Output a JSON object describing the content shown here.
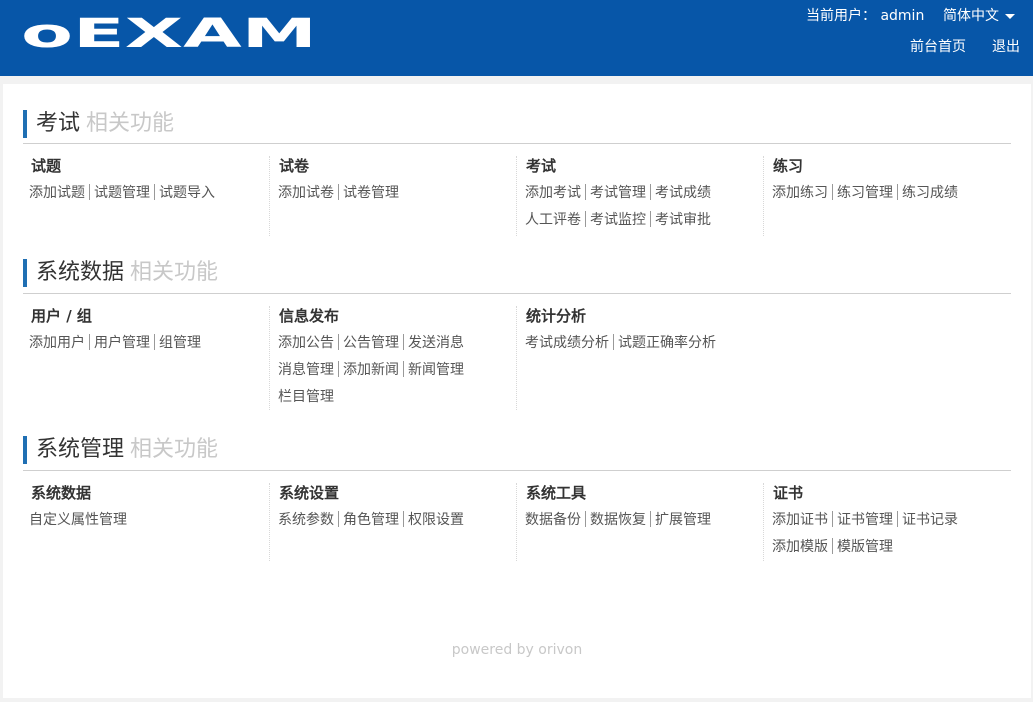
{
  "header": {
    "logo_text": "oEXAM",
    "current_user_label": "当前用户：",
    "current_user": "admin",
    "language": "简体中文",
    "front_home": "前台首页",
    "logout": "退出"
  },
  "sections": [
    {
      "title": "考试",
      "subtitle": "相关功能",
      "groups": [
        {
          "title": "试题",
          "rows": [
            [
              "添加试题",
              "试题管理",
              "试题导入"
            ]
          ]
        },
        {
          "title": "试卷",
          "rows": [
            [
              "添加试卷",
              "试卷管理"
            ]
          ]
        },
        {
          "title": "考试",
          "rows": [
            [
              "添加考试",
              "考试管理",
              "考试成绩"
            ],
            [
              "人工评卷",
              "考试监控",
              "考试审批"
            ]
          ]
        },
        {
          "title": "练习",
          "rows": [
            [
              "添加练习",
              "练习管理",
              "练习成绩"
            ]
          ]
        }
      ]
    },
    {
      "title": "系统数据",
      "subtitle": "相关功能",
      "groups": [
        {
          "title": "用户 / 组",
          "rows": [
            [
              "添加用户",
              "用户管理",
              "组管理"
            ]
          ]
        },
        {
          "title": "信息发布",
          "rows": [
            [
              "添加公告",
              "公告管理",
              "发送消息"
            ],
            [
              "消息管理",
              "添加新闻",
              "新闻管理"
            ],
            [
              "栏目管理"
            ]
          ]
        },
        {
          "title": "统计分析",
          "rows": [
            [
              "考试成绩分析",
              "试题正确率分析"
            ]
          ]
        }
      ]
    },
    {
      "title": "系统管理",
      "subtitle": "相关功能",
      "groups": [
        {
          "title": "系统数据",
          "rows": [
            [
              "自定义属性管理"
            ]
          ]
        },
        {
          "title": "系统设置",
          "rows": [
            [
              "系统参数",
              "角色管理",
              "权限设置"
            ]
          ]
        },
        {
          "title": "系统工具",
          "rows": [
            [
              "数据备份",
              "数据恢复",
              "扩展管理"
            ]
          ]
        },
        {
          "title": "证书",
          "rows": [
            [
              "添加证书",
              "证书管理",
              "证书记录"
            ],
            [
              "添加模版",
              "模版管理"
            ]
          ]
        }
      ]
    }
  ],
  "footer": {
    "text": "powered by orivon"
  }
}
